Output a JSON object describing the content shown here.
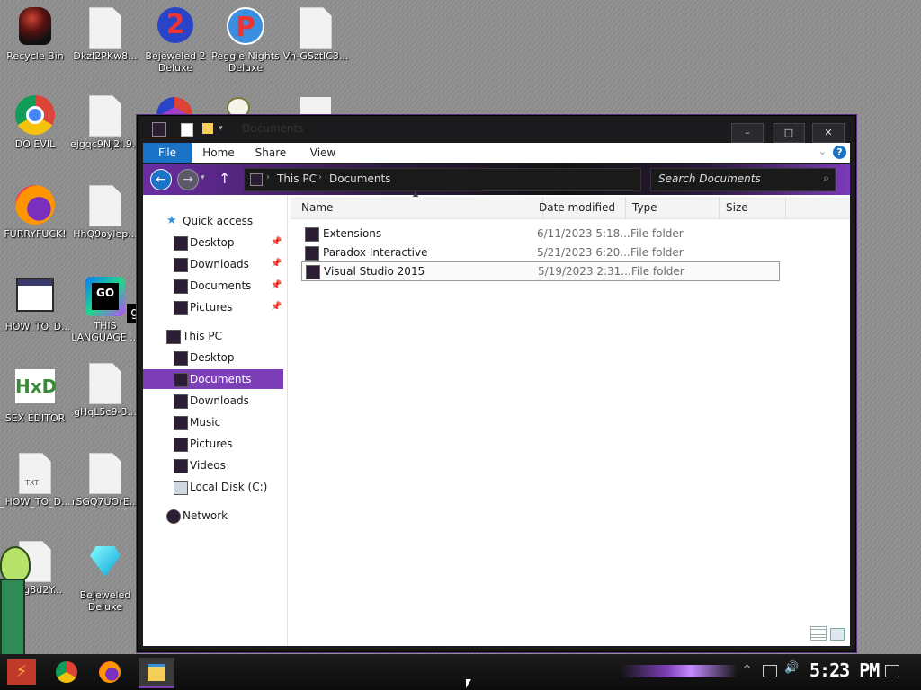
{
  "desktop": {
    "icons": [
      {
        "label": "Recycle Bin"
      },
      {
        "label": "DkzI2PKw8..."
      },
      {
        "label": "Bejeweled 2 Deluxe"
      },
      {
        "label": "Peggle Nights Deluxe"
      },
      {
        "label": "Vh-GSztIC3..."
      },
      {
        "label": "DO EVIL"
      },
      {
        "label": "ejgqc9Nj2I.9..."
      },
      {
        "label": "FURRYFUCK!"
      },
      {
        "label": "HhQ9oylep..."
      },
      {
        "label": "_HOW_TO_D..."
      },
      {
        "label": "THIS LANGUAGE ..."
      },
      {
        "label": "SEX EDITOR"
      },
      {
        "label": "gHqL5c9-3..."
      },
      {
        "label": "_HOW_TO_D..."
      },
      {
        "label": "rSGQ7UOrE..."
      },
      {
        "label": "...Eg8d2Y..."
      },
      {
        "label": "Bejeweled Deluxe"
      }
    ],
    "txt_badge": "TXT",
    "go_badge": "GO",
    "go_badge2": "go",
    "bejeweled_number": "2",
    "peggle_letter": "P",
    "hxd_letters": "HxD"
  },
  "window": {
    "title": "Documents",
    "buttons": {
      "minimize": "–",
      "maximize": "□",
      "close": "✕"
    },
    "ribbon_tabs": [
      "File",
      "Home",
      "Share",
      "View"
    ],
    "address": {
      "segments": [
        "This PC",
        "Documents"
      ]
    },
    "search": {
      "placeholder": "Search Documents"
    },
    "nav": {
      "quick_access": "Quick access",
      "qa_items": [
        "Desktop",
        "Downloads",
        "Documents",
        "Pictures"
      ],
      "this_pc": "This PC",
      "pc_items": [
        "Desktop",
        "Documents",
        "Downloads",
        "Music",
        "Pictures",
        "Videos",
        "Local Disk (C:)"
      ],
      "network": "Network"
    },
    "columns": [
      "Name",
      "Date modified",
      "Type",
      "Size"
    ],
    "rows": [
      {
        "name": "Extensions",
        "date": "6/11/2023 5:18...",
        "type": "File folder",
        "size": ""
      },
      {
        "name": "Paradox Interactive",
        "date": "5/21/2023 6:20...",
        "type": "File folder",
        "size": ""
      },
      {
        "name": "Visual Studio 2015",
        "date": "5/19/2023 2:31...",
        "type": "File folder",
        "size": ""
      }
    ],
    "selected_row": "Visual Studio 2015",
    "selected_nav": "Documents"
  },
  "taskbar": {
    "clock": "5:23 PM",
    "start_glyph": "⚡"
  },
  "colors": {
    "accent": "#7d3fb8",
    "file_tab": "#1a73c7"
  }
}
